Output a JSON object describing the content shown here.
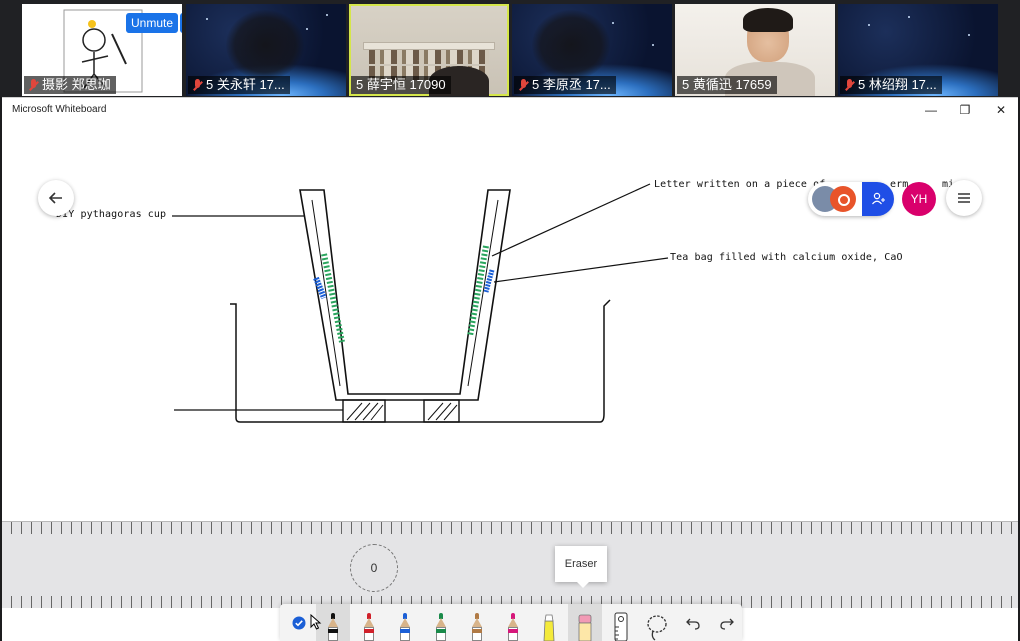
{
  "meeting": {
    "unmute_label": "Unmute",
    "more_label": "···",
    "participants": [
      {
        "label": "摄影 郑思珈",
        "muted": true
      },
      {
        "label": "5 关永轩 17...",
        "muted": true
      },
      {
        "label": "5 薛宇恒 17090",
        "muted": false
      },
      {
        "label": "5 李原丞 17...",
        "muted": true
      },
      {
        "label": "5 黄循迅 17659",
        "muted": false
      },
      {
        "label": "5 林绍翔 17...",
        "muted": true
      }
    ]
  },
  "window": {
    "title": "Microsoft Whiteboard",
    "minimize_icon": "—",
    "restore_icon": "❐",
    "close_icon": "✕"
  },
  "board": {
    "avatar_initials": "YH",
    "annotations": {
      "cup": "DIY pythagoras cup",
      "letter": "Letter written on a piece of",
      "letter_tail": "erm",
      "letter_tail2": "mi",
      "teabag": "Tea bag filled with calcium oxide, CaO"
    }
  },
  "ruler": {
    "angle": "0"
  },
  "toolbar": {
    "tooltip": "Eraser",
    "pen_colors": [
      "#111111",
      "#d0202a",
      "#1b5fd6",
      "#1a8a4a",
      "#b07a45",
      "#d6177a"
    ],
    "highlighter_color": "#f4ea3a",
    "eraser_color": "#f29ab5"
  }
}
